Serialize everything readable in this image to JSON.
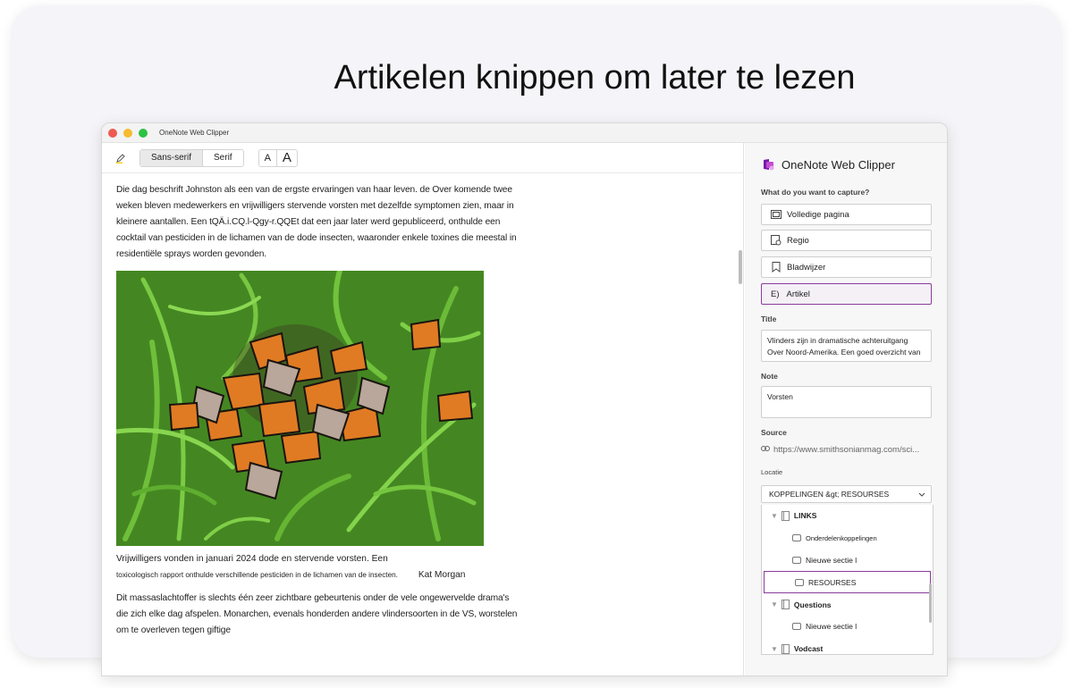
{
  "headline": "Artikelen knippen om later te lezen",
  "window": {
    "title": "OneNote Web Clipper"
  },
  "toolbar": {
    "font_sans": "Sans-serif",
    "font_serif": "Serif",
    "size_small": "A",
    "size_large": "A"
  },
  "article": {
    "paragraph1": "Die dag beschrift Johnston als een van de ergste ervaringen van haar leven. de Over komende twee weken bleven medewerkers en vrijwilligers stervende vorsten met dezelfde symptomen zien, maar in kleinere aantallen. Een tQÄ.i.CQ.l-Qgy-r.QQEt dat een jaar later werd gepubliceerd, onthulde een cocktail van pesticiden in de lichamen van de dode insecten, waaronder enkele toxines die meestal in residentiële sprays worden gevonden.",
    "caption_main": "Vrijwilligers vonden in januari 2024 dode en stervende vorsten. Een",
    "caption_small": "toxicologisch rapport onthulde verschillende pesticiden in de lichamen van de insecten.",
    "caption_credit": "Kat Morgan",
    "paragraph2": "Dit massaslachtoffer is slechts één zeer zichtbare gebeurtenis onder de vele ongewervelde drama's die zich elke dag afspelen. Monarchen, evenals honderden andere vlindersoorten in de VS, worstelen om te overleven tegen giftige"
  },
  "panel": {
    "brand": "OneNote Web Clipper",
    "capture_label": "What do you want to capture?",
    "options": [
      {
        "label": "Volledige pagina",
        "icon": "fullpage-icon"
      },
      {
        "label": "Regio",
        "icon": "region-icon"
      },
      {
        "label": "Bladwijzer",
        "icon": "bookmark-icon"
      },
      {
        "label": "Artikel",
        "prefix": "E)",
        "icon": "article-icon",
        "selected": true
      }
    ],
    "title_label": "Title",
    "title_value": "Vlinders zijn in dramatische achteruitgang Over Noord-Amerika. Een goed overzicht van",
    "note_label": "Note",
    "note_value": "Vorsten",
    "source_label": "Source",
    "source_value": "https://www.smithsonianmag.com/sci...",
    "location_label": "Locatie",
    "location_value": "KOPPELINGEN &gt; RESOURSES",
    "tree": [
      {
        "type": "notebook",
        "label": "LINKS"
      },
      {
        "type": "section",
        "label": "Onderdelenkoppelingen"
      },
      {
        "type": "section",
        "label": "Nieuwe sectie l"
      },
      {
        "type": "section",
        "label": "RESOURSES",
        "selected": true
      },
      {
        "type": "notebook",
        "label": "Questions"
      },
      {
        "type": "section",
        "label": "Nieuwe sectie l"
      },
      {
        "type": "notebook",
        "label": "Vodcast"
      }
    ]
  }
}
